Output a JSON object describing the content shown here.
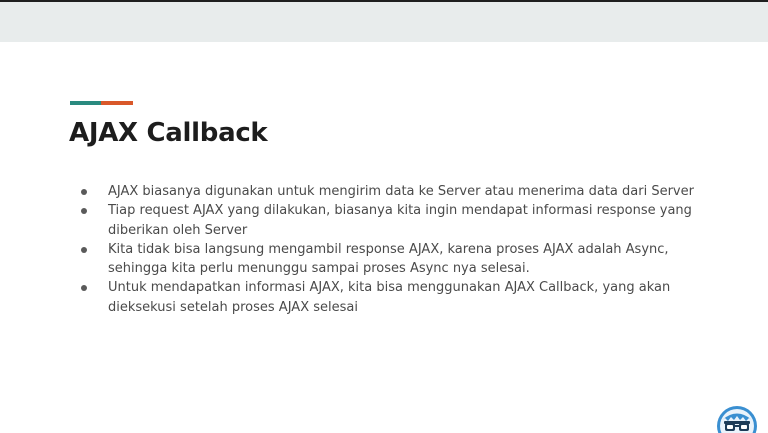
{
  "slide": {
    "title": "AJAX Callback",
    "bullets": [
      "AJAX biasanya digunakan untuk mengirim data ke Server atau menerima data dari Server",
      "Tiap request AJAX yang dilakukan, biasanya kita ingin mendapat informasi response yang diberikan oleh Server",
      "Kita tidak bisa langsung mengambil response AJAX, karena proses AJAX adalah Async, sehingga kita perlu menunggu sampai proses Async nya selesai.",
      "Untuk mendapatkan informasi AJAX, kita bisa menggunakan AJAX Callback, yang akan dieksekusi setelah proses AJAX selesai"
    ]
  },
  "colors": {
    "accent_teal": "#2a8a7f",
    "accent_orange": "#d9582a",
    "header_band": "#e8ecec",
    "logo_blue": "#3a8fd1"
  },
  "icons": {
    "logo": "glasses-character-logo-icon"
  }
}
